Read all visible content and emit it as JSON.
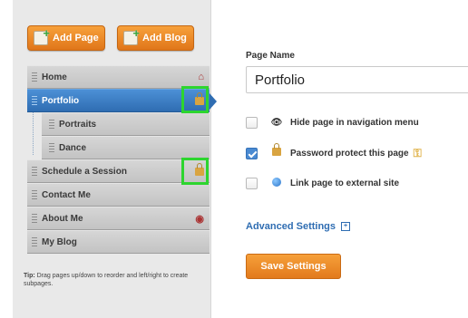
{
  "sidebar": {
    "add_page_label": "Add Page",
    "add_blog_label": "Add Blog",
    "pages": [
      {
        "label": "Home",
        "icon": "home-icon"
      },
      {
        "label": "Portfolio",
        "icon": "lock-icon",
        "active": true
      },
      {
        "label": "Portraits"
      },
      {
        "label": "Dance"
      },
      {
        "label": "Schedule a Session",
        "icon": "lock-icon"
      },
      {
        "label": "Contact Me"
      },
      {
        "label": "About Me",
        "icon": "hidden-icon"
      },
      {
        "label": "My Blog"
      }
    ],
    "tip_prefix": "Tip:",
    "tip_text": "Drag pages up/down to reorder and left/right to create subpages."
  },
  "main": {
    "page_name_label": "Page Name",
    "page_name_value": "Portfolio",
    "options": [
      {
        "label": "Hide page in navigation menu",
        "checked": false,
        "icon": "eye-icon"
      },
      {
        "label": "Password protect this page",
        "checked": true,
        "icon": "lock-icon"
      },
      {
        "label": "Link page to external site",
        "checked": false,
        "icon": "globe-icon"
      }
    ],
    "advanced_label": "Advanced Settings",
    "advanced_expand_glyph": "+",
    "save_label": "Save Settings"
  },
  "colors": {
    "accent_orange": "#e27a1c",
    "active_blue": "#2f6db2",
    "highlight_green": "#2dd52f"
  }
}
